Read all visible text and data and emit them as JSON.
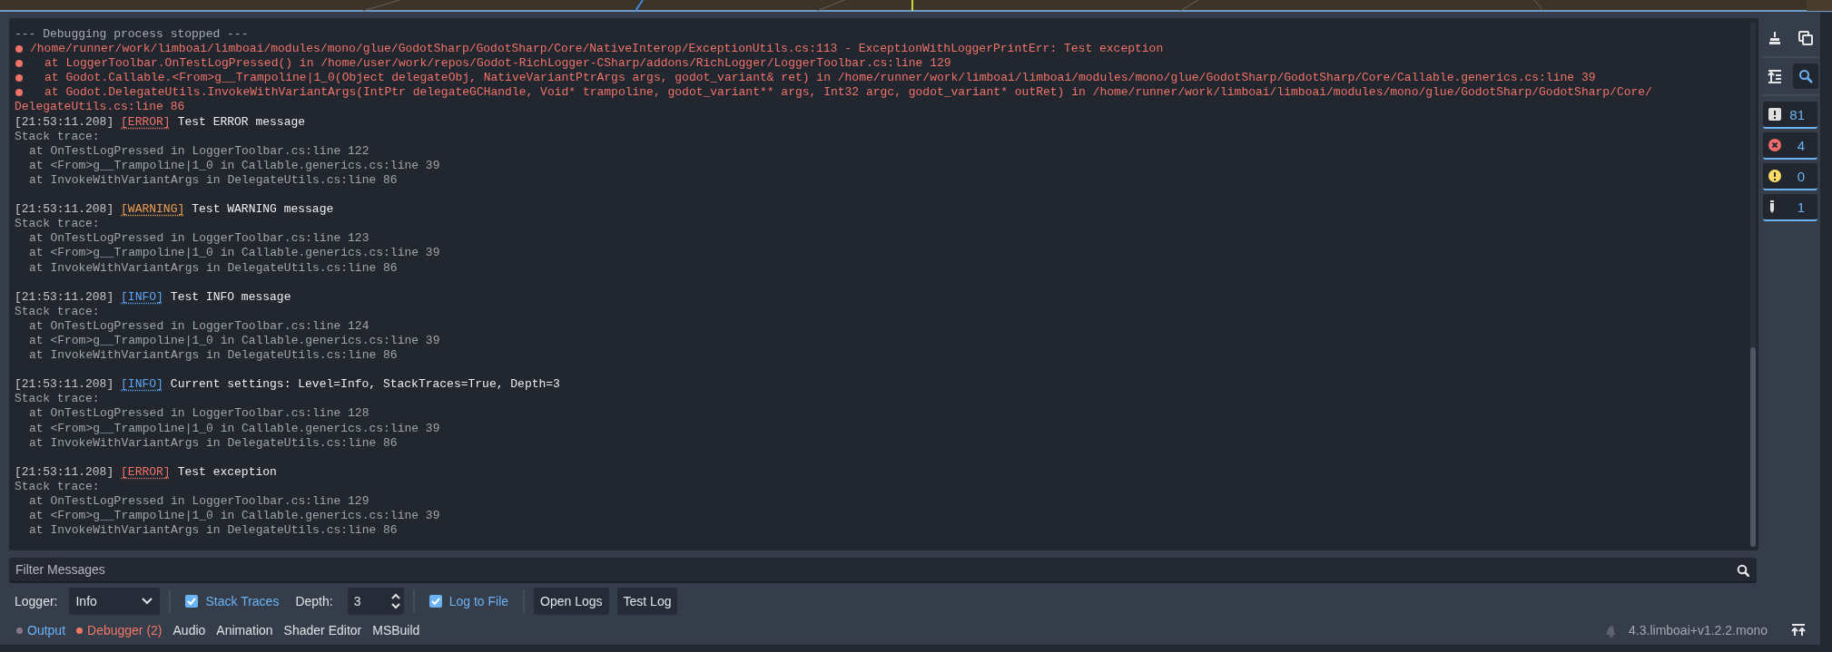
{
  "log": {
    "lines": [
      {
        "kind": "header",
        "text": "--- Debugging process stopped ---"
      },
      {
        "kind": "error",
        "text": "/home/runner/work/limboai/limboai/modules/mono/glue/GodotSharp/GodotSharp/Core/NativeInterop/ExceptionUtils.cs:113 - ExceptionWithLoggerPrintErr: Test exception"
      },
      {
        "kind": "error_frame",
        "text": "at LoggerToolbar.OnTestLogPressed() in /home/user/work/repos/Godot-RichLogger-CSharp/addons/RichLogger/LoggerToolbar.cs:line 129"
      },
      {
        "kind": "error_frame",
        "text": "at Godot.Callable.<From>g__Trampoline|1_0(Object delegateObj, NativeVariantPtrArgs args, godot_variant& ret) in /home/runner/work/limboai/limboai/modules/mono/glue/GodotSharp/GodotSharp/Core/Callable.generics.cs:line 39"
      },
      {
        "kind": "error_frame",
        "text": "at Godot.DelegateUtils.InvokeWithVariantArgs(IntPtr delegateGCHandle, Void* trampoline, godot_variant** args, Int32 argc, godot_variant* outRet) in /home/runner/work/limboai/limboai/modules/mono/glue/GodotSharp/GodotSharp/Core/"
      },
      {
        "kind": "wrap",
        "text": "DelegateUtils.cs:line 86"
      },
      {
        "kind": "entry",
        "time": "[21:53:11.208]",
        "color": "#f07369",
        "tag": "[ERROR]",
        "message": "Test ERROR message"
      },
      {
        "kind": "trace",
        "text": "Stack trace:"
      },
      {
        "kind": "frame",
        "text": "at OnTestLogPressed in LoggerToolbar.cs:line 122"
      },
      {
        "kind": "frame",
        "text": "at <From>g__Trampoline|1_0 in Callable.generics.cs:line 39"
      },
      {
        "kind": "frame",
        "text": "at InvokeWithVariantArgs in DelegateUtils.cs:line 86"
      },
      {
        "kind": "entry",
        "time": "[21:53:11.208]",
        "color": "#ec9d4d",
        "tag": "[WARNING]",
        "message": "Test WARNING message"
      },
      {
        "kind": "trace",
        "text": "Stack trace:"
      },
      {
        "kind": "frame",
        "text": "at OnTestLogPressed in LoggerToolbar.cs:line 123"
      },
      {
        "kind": "frame",
        "text": "at <From>g__Trampoline|1_0 in Callable.generics.cs:line 39"
      },
      {
        "kind": "frame",
        "text": "at InvokeWithVariantArgs in DelegateUtils.cs:line 86"
      },
      {
        "kind": "entry",
        "time": "[21:53:11.208]",
        "color": "#5aa8f5",
        "tag": "[INFO]",
        "message": "Test INFO message"
      },
      {
        "kind": "trace",
        "text": "Stack trace:"
      },
      {
        "kind": "frame",
        "text": "at OnTestLogPressed in LoggerToolbar.cs:line 124"
      },
      {
        "kind": "frame",
        "text": "at <From>g__Trampoline|1_0 in Callable.generics.cs:line 39"
      },
      {
        "kind": "frame",
        "text": "at InvokeWithVariantArgs in DelegateUtils.cs:line 86"
      },
      {
        "kind": "entry",
        "time": "[21:53:11.208]",
        "color": "#5aa8f5",
        "tag": "[INFO]",
        "message": "Current settings: Level=Info, StackTraces=True, Depth=3"
      },
      {
        "kind": "trace",
        "text": "Stack trace:"
      },
      {
        "kind": "frame",
        "text": "at OnTestLogPressed in LoggerToolbar.cs:line 128"
      },
      {
        "kind": "frame",
        "text": "at <From>g__Trampoline|1_0 in Callable.generics.cs:line 39"
      },
      {
        "kind": "frame",
        "text": "at InvokeWithVariantArgs in DelegateUtils.cs:line 86"
      },
      {
        "kind": "entry",
        "time": "[21:53:11.208]",
        "color": "#f07369",
        "tag": "[ERROR]",
        "message": "Test exception"
      },
      {
        "kind": "trace",
        "text": "Stack trace:"
      },
      {
        "kind": "frame",
        "text": "at OnTestLogPressed in LoggerToolbar.cs:line 129"
      },
      {
        "kind": "frame",
        "text": "at <From>g__Trampoline|1_0 in Callable.generics.cs:line 39"
      },
      {
        "kind": "frame",
        "text": "at InvokeWithVariantArgs in DelegateUtils.cs:line 86"
      }
    ]
  },
  "sidebar": {
    "tools": [
      {
        "kind": "clear",
        "on": false
      },
      {
        "kind": "copy",
        "on": false
      },
      {
        "kind": "collapse",
        "on": false
      },
      {
        "kind": "search",
        "on": true
      }
    ],
    "filters": [
      {
        "kind": "message",
        "count": "81",
        "on": true
      },
      {
        "kind": "error",
        "count": "4",
        "on": true
      },
      {
        "kind": "warning",
        "count": "0",
        "on": true
      },
      {
        "kind": "editor",
        "count": "1",
        "on": true
      }
    ]
  },
  "filter": {
    "placeholder": "Filter Messages"
  },
  "toolbar": {
    "logger_label": "Logger:",
    "logger_value": "Info",
    "stack_traces": {
      "label": "Stack Traces",
      "checked": true
    },
    "depth_label": "Depth:",
    "depth_value": "3",
    "log_to_file": {
      "label": "Log to File",
      "checked": true
    },
    "buttons": [
      "Open Logs",
      "Test Log"
    ]
  },
  "tabs": [
    {
      "label": "Output",
      "selected": true,
      "alert": false,
      "color": "#85788a"
    },
    {
      "label": "Debugger (2)",
      "selected": false,
      "alert": true,
      "color": "#f07866"
    },
    {
      "label": "Audio",
      "selected": false,
      "alert": false
    },
    {
      "label": "Animation",
      "selected": false,
      "alert": false
    },
    {
      "label": "Shader Editor",
      "selected": false,
      "alert": false
    },
    {
      "label": "MSBuild",
      "selected": false,
      "alert": false
    }
  ],
  "status": {
    "version": "4.3.limboai+v1.2.2.mono"
  }
}
